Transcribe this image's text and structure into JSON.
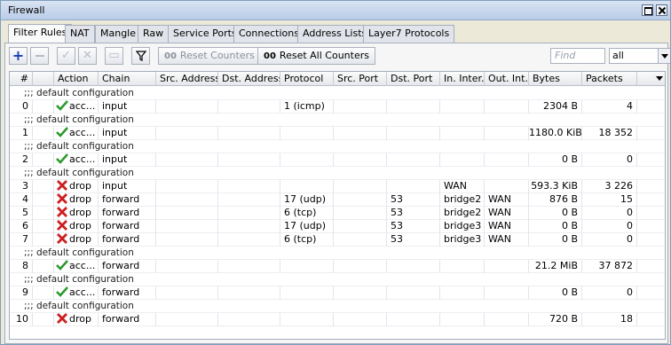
{
  "window": {
    "title": "Firewall"
  },
  "tabs": [
    "Filter Rules",
    "NAT",
    "Mangle",
    "Raw",
    "Service Ports",
    "Connections",
    "Address Lists",
    "Layer7 Protocols"
  ],
  "toolbar": {
    "reset_counters": "Reset Counters",
    "reset_all_counters": "Reset All Counters",
    "counter_glyph": "00",
    "find_placeholder": "Find",
    "filter_value": "all"
  },
  "columns": [
    "#",
    "Action",
    "Chain",
    "Src. Address",
    "Dst. Address",
    "Protocol",
    "Src. Port",
    "Dst. Port",
    "In. Inter...",
    "Out. Int...",
    "Bytes",
    "Packets"
  ],
  "rows": [
    {
      "comment": ";;; default configuration",
      "num": "0",
      "action": "acc...",
      "action_type": "accept",
      "chain": "input",
      "src_addr": "",
      "dst_addr": "",
      "protocol": "1 (icmp)",
      "src_port": "",
      "dst_port": "",
      "in_if": "",
      "out_if": "",
      "bytes": "2304 B",
      "packets": "4"
    },
    {
      "comment": ";;; default configuration",
      "num": "1",
      "action": "acc...",
      "action_type": "accept",
      "chain": "input",
      "src_addr": "",
      "dst_addr": "",
      "protocol": "",
      "src_port": "",
      "dst_port": "",
      "in_if": "",
      "out_if": "",
      "bytes": "1180.0 KiB",
      "packets": "18 352"
    },
    {
      "comment": ";;; default configuration",
      "num": "2",
      "action": "acc...",
      "action_type": "accept",
      "chain": "input",
      "src_addr": "",
      "dst_addr": "",
      "protocol": "",
      "src_port": "",
      "dst_port": "",
      "in_if": "",
      "out_if": "",
      "bytes": "0 B",
      "packets": "0"
    },
    {
      "comment": ";;; default configuration",
      "num": "3",
      "action": "drop",
      "action_type": "drop",
      "chain": "input",
      "src_addr": "",
      "dst_addr": "",
      "protocol": "",
      "src_port": "",
      "dst_port": "",
      "in_if": "WAN",
      "out_if": "",
      "bytes": "593.3 KiB",
      "packets": "3 226"
    },
    {
      "comment": "",
      "num": "4",
      "action": "drop",
      "action_type": "drop",
      "chain": "forward",
      "src_addr": "",
      "dst_addr": "",
      "protocol": "17 (udp)",
      "src_port": "",
      "dst_port": "53",
      "in_if": "bridge2",
      "out_if": "WAN",
      "bytes": "876 B",
      "packets": "15"
    },
    {
      "comment": "",
      "num": "5",
      "action": "drop",
      "action_type": "drop",
      "chain": "forward",
      "src_addr": "",
      "dst_addr": "",
      "protocol": "6 (tcp)",
      "src_port": "",
      "dst_port": "53",
      "in_if": "bridge2",
      "out_if": "WAN",
      "bytes": "0 B",
      "packets": "0"
    },
    {
      "comment": "",
      "num": "6",
      "action": "drop",
      "action_type": "drop",
      "chain": "forward",
      "src_addr": "",
      "dst_addr": "",
      "protocol": "17 (udp)",
      "src_port": "",
      "dst_port": "53",
      "in_if": "bridge3",
      "out_if": "WAN",
      "bytes": "0 B",
      "packets": "0"
    },
    {
      "comment": "",
      "num": "7",
      "action": "drop",
      "action_type": "drop",
      "chain": "forward",
      "src_addr": "",
      "dst_addr": "",
      "protocol": "6 (tcp)",
      "src_port": "",
      "dst_port": "53",
      "in_if": "bridge3",
      "out_if": "WAN",
      "bytes": "0 B",
      "packets": "0"
    },
    {
      "comment": ";;; default configuration",
      "num": "8",
      "action": "acc...",
      "action_type": "accept",
      "chain": "forward",
      "src_addr": "",
      "dst_addr": "",
      "protocol": "",
      "src_port": "",
      "dst_port": "",
      "in_if": "",
      "out_if": "",
      "bytes": "21.2 MiB",
      "packets": "37 872"
    },
    {
      "comment": ";;; default configuration",
      "num": "9",
      "action": "acc...",
      "action_type": "accept",
      "chain": "forward",
      "src_addr": "",
      "dst_addr": "",
      "protocol": "",
      "src_port": "",
      "dst_port": "",
      "in_if": "",
      "out_if": "",
      "bytes": "0 B",
      "packets": "0"
    },
    {
      "comment": ";;; default configuration",
      "num": "10",
      "action": "drop",
      "action_type": "drop",
      "chain": "forward",
      "src_addr": "",
      "dst_addr": "",
      "protocol": "",
      "src_port": "",
      "dst_port": "",
      "in_if": "",
      "out_if": "",
      "bytes": "720 B",
      "packets": "18"
    }
  ],
  "colors": {
    "accept": "#2e9a2e",
    "drop": "#cc1f1f",
    "add_icon": "#1a3db5",
    "titlebar": "#c6d6ee"
  },
  "icons": {
    "accept": "check-icon",
    "drop": "cross-icon"
  }
}
